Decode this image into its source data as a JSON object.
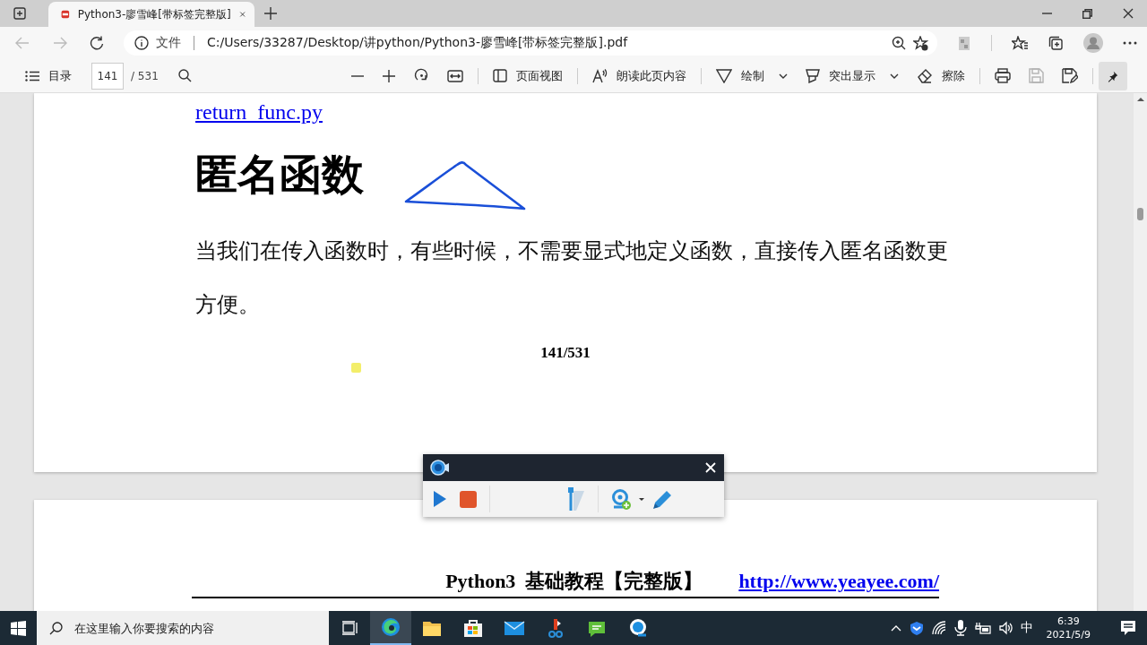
{
  "browser": {
    "tabs": [
      {
        "title": "Python3-廖雪峰[带标签完整版]",
        "selected": true
      }
    ],
    "address": {
      "scheme_label": "文件",
      "url": "C:/Users/33287/Desktop/讲python/Python3-廖雪峰[带标签完整版].pdf"
    }
  },
  "pdf_toolbar": {
    "contents_label": "目录",
    "page_number": "141",
    "page_total": "/ 531",
    "pinned": true,
    "tools": [
      {
        "kind": "zoom-out",
        "disabled": false
      },
      {
        "kind": "zoom-in",
        "disabled": false
      },
      {
        "kind": "rotate",
        "disabled": false
      },
      {
        "kind": "fit",
        "disabled": false
      },
      {
        "kind": "divider"
      },
      {
        "kind": "page-view",
        "label": "页面视图",
        "disabled": false
      },
      {
        "kind": "divider"
      },
      {
        "kind": "read-aloud",
        "label": "朗读此页内容",
        "disabled": false
      },
      {
        "kind": "divider"
      },
      {
        "kind": "draw",
        "label": "绘制",
        "dropdown": true,
        "disabled": false
      },
      {
        "kind": "highlight",
        "label": "突出显示",
        "dropdown": true,
        "disabled": false
      },
      {
        "kind": "erase",
        "label": "擦除",
        "disabled": false
      },
      {
        "kind": "divider"
      },
      {
        "kind": "print",
        "disabled": false
      },
      {
        "kind": "save",
        "disabled": true
      },
      {
        "kind": "save-as",
        "disabled": false
      }
    ]
  },
  "document": {
    "page": {
      "link": "return_func.py",
      "heading": "匿名函数",
      "paragraph": "当我们在传入函数时，有些时候，不需要显式地定义函数，直接传入匿名函数更方便。",
      "page_label": "141/531"
    },
    "next_page": {
      "header_title": "Python3  基础教程【完整版】",
      "header_link": "http://www.yeayee.com/"
    }
  },
  "taskbar": {
    "search": {
      "placeholder": "在这里输入你要搜索的内容"
    },
    "apps": [
      {
        "kind": "task-view",
        "selected": false
      },
      {
        "kind": "edge",
        "selected": true
      },
      {
        "kind": "folder",
        "selected": false
      },
      {
        "kind": "store",
        "selected": false
      },
      {
        "kind": "mail",
        "selected": false
      },
      {
        "kind": "red-app",
        "selected": false
      },
      {
        "kind": "green-app",
        "selected": false
      },
      {
        "kind": "blue-app",
        "selected": false
      }
    ],
    "ime": "中",
    "time": "6:39",
    "date": "2021/5/9"
  }
}
